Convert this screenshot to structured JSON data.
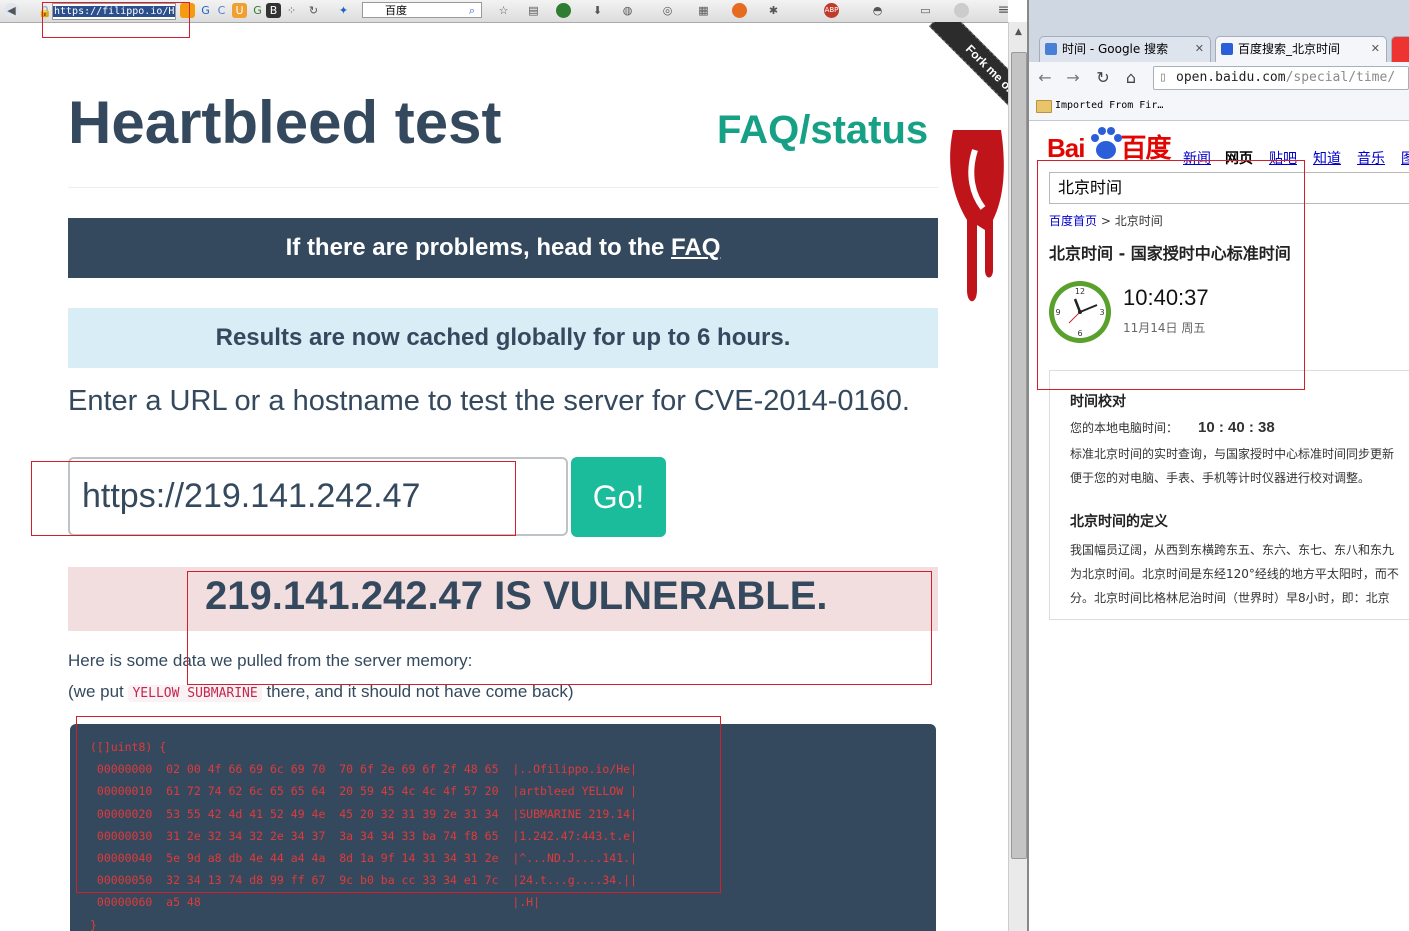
{
  "firefox": {
    "url": "https://filippo.io/H",
    "search_engine_label": "百度"
  },
  "heartbleed": {
    "title": "Heartbleed test",
    "faq_link": "FAQ/status",
    "ribbon": "Fork me on GitHub",
    "banner_text": "If there are problems, head to the ",
    "banner_link": "FAQ",
    "cache_notice": "Results are now cached globally for up to 6 hours.",
    "lead": "Enter a URL or a hostname to test the server for CVE-2014-0160.",
    "host_input_value": "https://219.141.242.47",
    "go_button": "Go!",
    "result": "219.141.242.47 IS VULNERABLE.",
    "memory_intro": "Here is some data we pulled from the server memory:",
    "memory_note_prefix": "(we put ",
    "memory_note_code": "YELLOW SUBMARINE",
    "memory_note_suffix": " there, and it should not have come back)",
    "dump_lines": [
      "([]uint8) {",
      " 00000000  02 00 4f 66 69 6c 69 70  70 6f 2e 69 6f 2f 48 65  |..Ofilippo.io/He|",
      " 00000010  61 72 74 62 6c 65 65 64  20 59 45 4c 4c 4f 57 20  |artbleed YELLOW |",
      " 00000020  53 55 42 4d 41 52 49 4e  45 20 32 31 39 2e 31 34  |SUBMARINE 219.14|",
      " 00000030  31 2e 32 34 32 2e 34 37  3a 34 34 33 ba 74 f8 65  |1.242.47:443.t.e|",
      " 00000040  5e 9d a8 db 4e 44 a4 4a  8d 1a 9f 14 31 34 31 2e  |^...ND.J....141.|",
      " 00000050  32 34 13 74 d8 99 ff 67  9c b0 ba cc 33 34 e1 7c  |24.t...g....34.||",
      " 00000060  a5 48                                             |.H|",
      "}"
    ]
  },
  "chrome": {
    "tabs": [
      {
        "label": "时间 - Google 搜索",
        "favicon_color": "#4a7fd6"
      },
      {
        "label": "百度搜索_北京时间",
        "favicon_color": "#2b5fd9"
      }
    ],
    "address_host": "open.baidu.com",
    "address_path": "/special/time/",
    "bookmark_folder": "Imported From Fir…"
  },
  "baidu": {
    "logo_left": "Bai",
    "logo_right": "百度",
    "nav": [
      "新闻",
      "网页",
      "贴吧",
      "知道",
      "音乐",
      "图"
    ],
    "query": "北京时间",
    "crumb_home": "百度首页",
    "crumb_sep": ">",
    "crumb_current": "北京时间",
    "result_title": "北京时间 - 国家授时中心标准时间",
    "time": "10:40:37",
    "date": "11月14日  周五",
    "calib_heading": "时间校对",
    "local_time_label": "您的本地电脑时间：",
    "local_time": "10 : 40 : 38",
    "calib_text_1": "标准北京时间的实时查询，与国家授时中心标准时间同步更新",
    "calib_text_2": "便于您的对电脑、手表、手机等计时仪器进行校对调整。",
    "def_heading": "北京时间的定义",
    "def_text_1": "我国幅员辽阔，从西到东横跨东五、东六、东七、东八和东九",
    "def_text_2": "为北京时间。北京时间是东经120°经线的地方平太阳时，而不",
    "def_text_3": "分。北京时间比格林尼治时间（世界时）早8小时，即：北京"
  }
}
